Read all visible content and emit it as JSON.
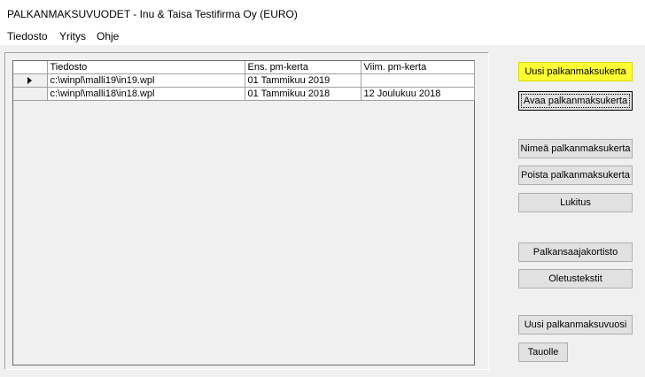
{
  "window": {
    "title": "PALKANMAKSUVUODET - Inu & Taisa Testifirma Oy (EURO)"
  },
  "menu": [
    {
      "label": "Tiedosto"
    },
    {
      "label": "Yritys"
    },
    {
      "label": "Ohje"
    }
  ],
  "grid": {
    "columns": [
      "Tiedosto",
      "Ens. pm-kerta",
      "Viim. pm-kerta"
    ],
    "rows": [
      {
        "file": "c:\\winpl\\malli19\\in19.wpl",
        "first": "01 Tammikuu 2019",
        "last": "",
        "current": true
      },
      {
        "file": "c:\\winpl\\malli18\\in18.wpl",
        "first": "01 Tammikuu 2018",
        "last": "12 Joulukuu 2018",
        "current": false
      }
    ]
  },
  "buttons": {
    "new_run": "Uusi palkanmaksukerta",
    "open_run": "Avaa palkanmaksukerta",
    "rename_run": "Nimeä palkanmaksukerta",
    "delete_run": "Poista palkanmaksukerta",
    "lock": "Lukitus",
    "employee_cards": "Palkansaajakortisto",
    "default_texts": "Oletustekstit",
    "new_year": "Uusi palkanmaksuvuosi",
    "back": "Tauolle"
  },
  "colors": {
    "highlight": "#ffff33"
  }
}
